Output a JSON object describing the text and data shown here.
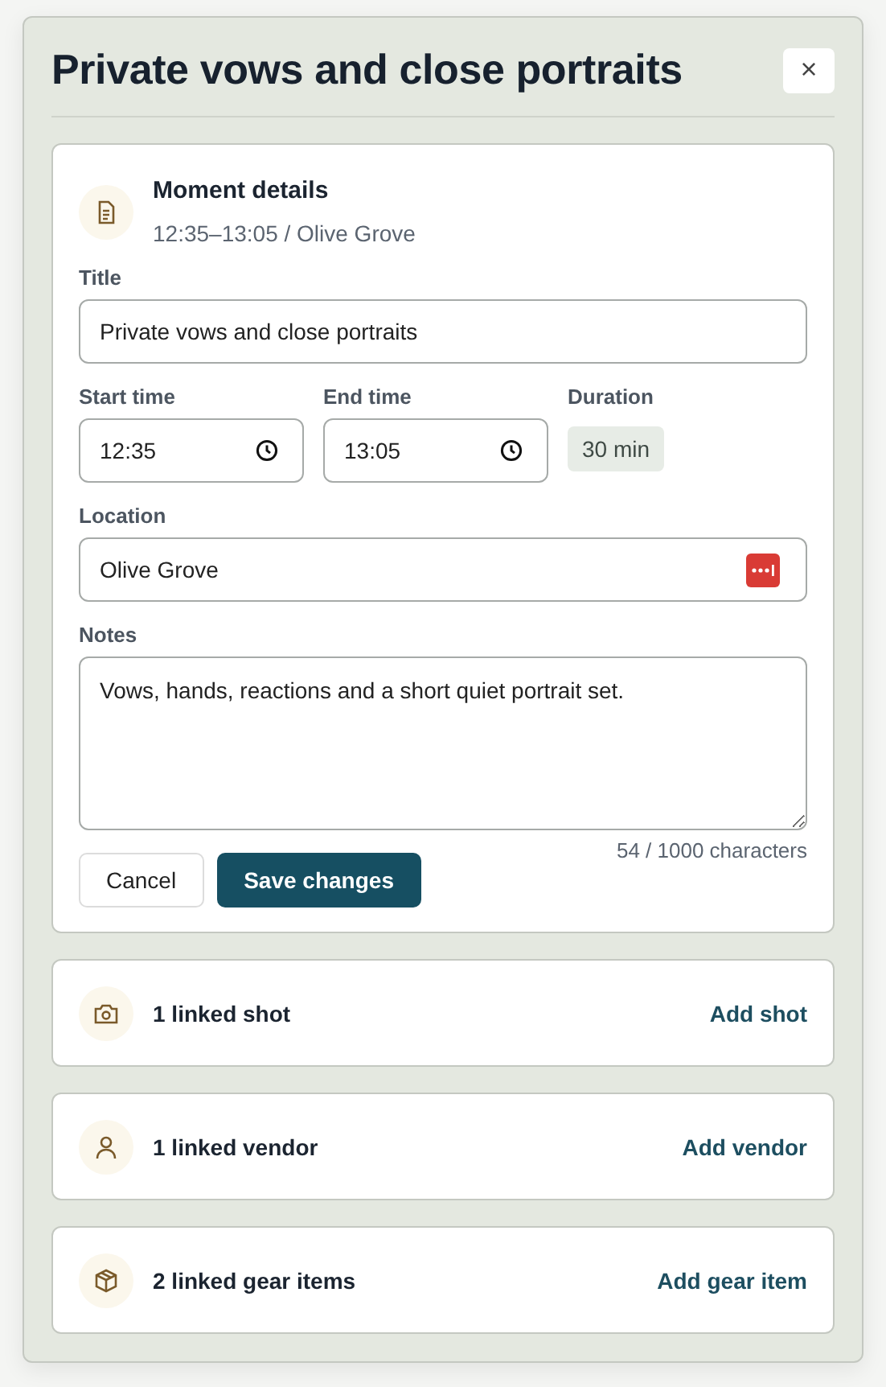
{
  "dialog": {
    "title": "Private vows and close portraits",
    "close": "×"
  },
  "details": {
    "heading": "Moment details",
    "summary": "12:35–13:05 / Olive Grove",
    "title_label": "Title",
    "title_value": "Private vows and close portraits",
    "start_label": "Start time",
    "start_value": "12:35",
    "end_label": "End time",
    "end_value": "13:05",
    "duration_label": "Duration",
    "duration_value": "30 min",
    "location_label": "Location",
    "location_value": "Olive Grove",
    "notes_label": "Notes",
    "notes_value": "Vows, hands, reactions and a short quiet portrait set.",
    "counter": "54 / 1000 characters",
    "cancel": "Cancel",
    "save": "Save changes"
  },
  "links": [
    {
      "kind": "shot",
      "label": "1 linked shot",
      "action": "Add shot"
    },
    {
      "kind": "vendor",
      "label": "1 linked vendor",
      "action": "Add vendor"
    },
    {
      "kind": "gear",
      "label": "2 linked gear items",
      "action": "Add gear item"
    }
  ]
}
